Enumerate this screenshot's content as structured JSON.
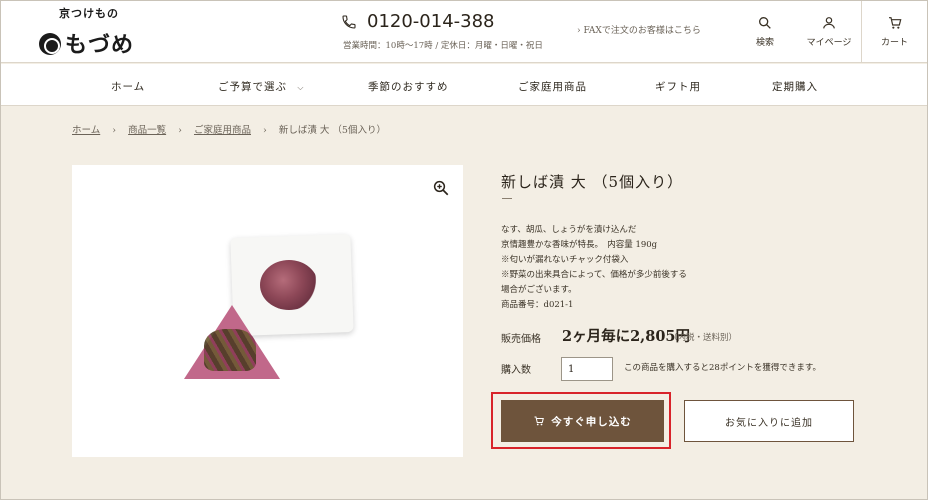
{
  "brand": {
    "small_text": "京つけもの",
    "big_text": "もづめ",
    "crest_icon": "crest-icon"
  },
  "header": {
    "phone_number": "0120-014-388",
    "hours": "営業時間：10時～17時 / 定休日：月曜・日曜・祝日",
    "fax_link": "› FAXで注文のお客様はこちら",
    "search_label": "検索",
    "mypage_label": "マイページ",
    "cart_label": "カート"
  },
  "nav": {
    "items": [
      "ホーム",
      "ご予算で選ぶ",
      "季節のおすすめ",
      "ご家庭用商品",
      "ギフト用",
      "定期購入"
    ]
  },
  "breadcrumb": {
    "items": [
      "ホーム",
      "商品一覧",
      "ご家庭用商品",
      "新しば漬 大 （5個入り）"
    ]
  },
  "product": {
    "title": "新しば漬 大 （5個入り）",
    "description": [
      "なす、胡瓜、しょうがを漬け込んだ",
      "京情趣豊かな香味が特長。　内容量 190g",
      "※匂いが漏れないチャック付袋入",
      "※野菜の出来具合によって、価格が多少前後する",
      "場合がございます。",
      "商品番号：d021-1"
    ],
    "price_label": "販売価格",
    "price": "2ヶ月毎に2,805円",
    "price_note": "（内税・送料別）",
    "qty_label": "購入数",
    "qty_value": "1",
    "points_text": "この商品を購入すると28ポイントを獲得できます。",
    "buy_label": "今すぐ申し込む",
    "fav_label": "お気に入りに追加"
  },
  "colors": {
    "accent": "#6e543c",
    "highlight": "#d8232a",
    "background": "#f3eee4"
  }
}
